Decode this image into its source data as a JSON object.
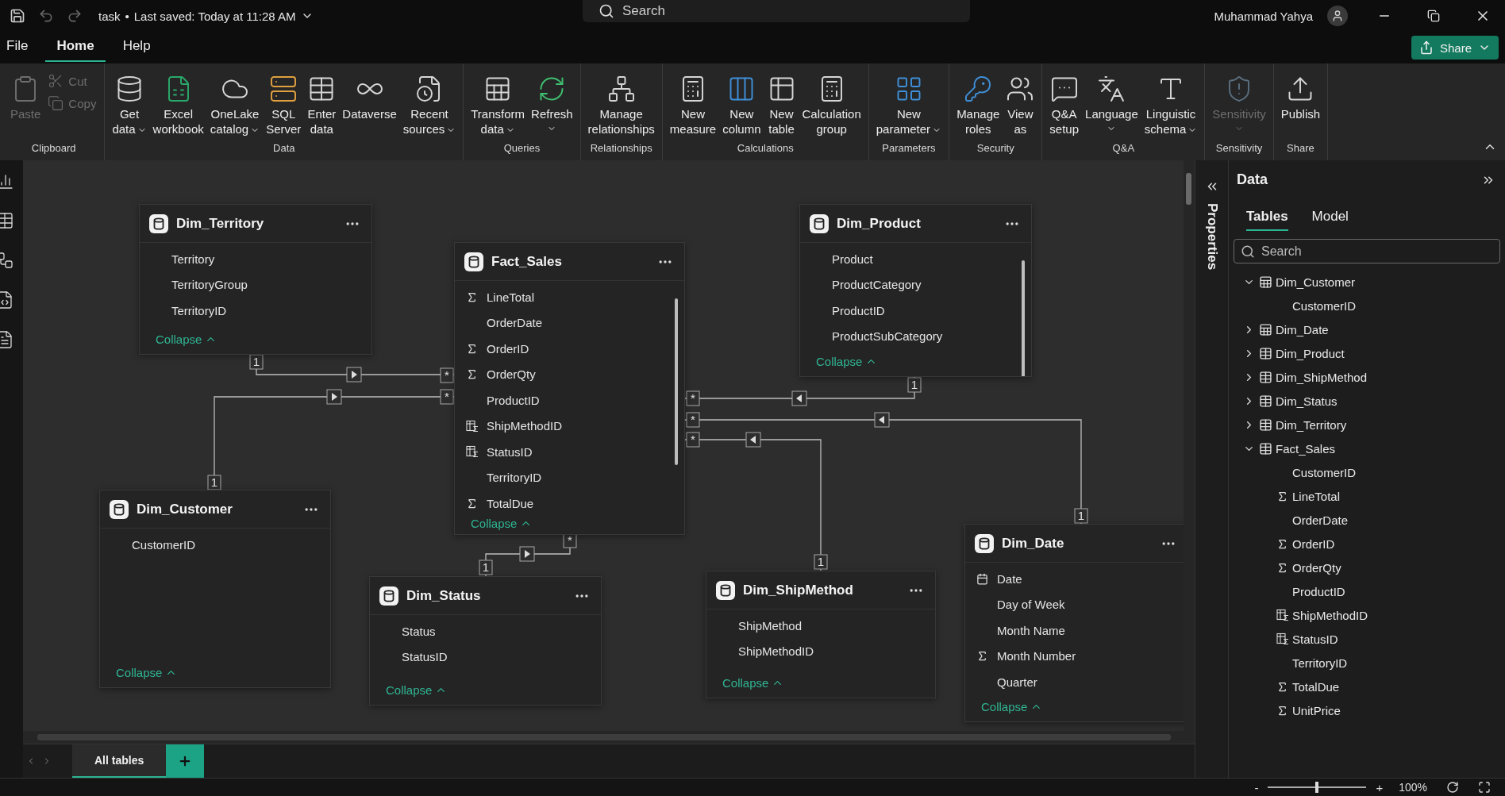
{
  "title_bar": {
    "file_name": "task",
    "separator": "•",
    "saved": "Last saved: Today at 11:28 AM",
    "search_placeholder": "Search",
    "user": "Muhammad Yahya"
  },
  "menu": [
    {
      "label": "File",
      "selected": false
    },
    {
      "label": "Home",
      "selected": true
    },
    {
      "label": "Help",
      "selected": false
    }
  ],
  "share_button": "Share",
  "ribbon": [
    {
      "label": "Clipboard",
      "buttons": [
        {
          "kind": "large",
          "lines": [
            "Paste"
          ],
          "dropdown": false,
          "disabled": true
        },
        {
          "kind": "small",
          "lines": [
            "Cut"
          ],
          "disabled": true
        },
        {
          "kind": "small",
          "lines": [
            "Copy"
          ],
          "disabled": true
        }
      ]
    },
    {
      "label": "Data",
      "buttons": [
        {
          "kind": "large",
          "lines": [
            "Get",
            "data"
          ],
          "dropdown": true,
          "disabled": false
        },
        {
          "kind": "large",
          "lines": [
            "Excel",
            "workbook"
          ],
          "dropdown": false,
          "disabled": false
        },
        {
          "kind": "large",
          "lines": [
            "OneLake",
            "catalog"
          ],
          "dropdown": true,
          "disabled": false
        },
        {
          "kind": "large",
          "lines": [
            "SQL",
            "Server"
          ],
          "dropdown": false,
          "disabled": false
        },
        {
          "kind": "large",
          "lines": [
            "Enter",
            "data"
          ],
          "dropdown": false,
          "disabled": false
        },
        {
          "kind": "large",
          "lines": [
            "Dataverse"
          ],
          "dropdown": false,
          "disabled": false
        },
        {
          "kind": "large",
          "lines": [
            "Recent",
            "sources"
          ],
          "dropdown": true,
          "disabled": false
        }
      ]
    },
    {
      "label": "Queries",
      "buttons": [
        {
          "kind": "large",
          "lines": [
            "Transform",
            "data"
          ],
          "dropdown": true,
          "disabled": false
        },
        {
          "kind": "large",
          "lines": [
            "Refresh"
          ],
          "dropdown": true,
          "disabled": false
        }
      ]
    },
    {
      "label": "Relationships",
      "buttons": [
        {
          "kind": "large",
          "lines": [
            "Manage",
            "relationships"
          ],
          "dropdown": false,
          "disabled": false
        }
      ]
    },
    {
      "label": "Calculations",
      "buttons": [
        {
          "kind": "large",
          "lines": [
            "New",
            "measure"
          ],
          "dropdown": false,
          "disabled": false
        },
        {
          "kind": "large",
          "lines": [
            "New",
            "column"
          ],
          "dropdown": false,
          "disabled": false
        },
        {
          "kind": "large",
          "lines": [
            "New",
            "table"
          ],
          "dropdown": false,
          "disabled": false
        },
        {
          "kind": "large",
          "lines": [
            "Calculation",
            "group"
          ],
          "dropdown": false,
          "disabled": false
        }
      ]
    },
    {
      "label": "Parameters",
      "buttons": [
        {
          "kind": "large",
          "lines": [
            "New",
            "parameter"
          ],
          "dropdown": true,
          "disabled": false
        }
      ]
    },
    {
      "label": "Security",
      "buttons": [
        {
          "kind": "large",
          "lines": [
            "Manage",
            "roles"
          ],
          "dropdown": false,
          "disabled": false
        },
        {
          "kind": "large",
          "lines": [
            "View",
            "as"
          ],
          "dropdown": false,
          "disabled": false
        }
      ]
    },
    {
      "label": "Q&A",
      "buttons": [
        {
          "kind": "large",
          "lines": [
            "Q&A",
            "setup"
          ],
          "dropdown": false,
          "disabled": false
        },
        {
          "kind": "large",
          "lines": [
            "Language"
          ],
          "dropdown": true,
          "disabled": false
        },
        {
          "kind": "large",
          "lines": [
            "Linguistic",
            "schema"
          ],
          "dropdown": true,
          "disabled": false
        }
      ]
    },
    {
      "label": "Sensitivity",
      "buttons": [
        {
          "kind": "large",
          "lines": [
            "Sensitivity"
          ],
          "dropdown": true,
          "disabled": true
        }
      ]
    },
    {
      "label": "Share",
      "buttons": [
        {
          "kind": "large",
          "lines": [
            "Publish"
          ],
          "dropdown": false,
          "disabled": false
        }
      ]
    }
  ],
  "tables": [
    {
      "name": "Dim_Territory",
      "scrollable": false,
      "collapse": "Collapse",
      "fields": [
        {
          "name": "Territory",
          "kind": "plain"
        },
        {
          "name": "TerritoryGroup",
          "kind": "plain"
        },
        {
          "name": "TerritoryID",
          "kind": "plain"
        }
      ]
    },
    {
      "name": "Fact_Sales",
      "scrollable": true,
      "collapse": "Collapse",
      "fields": [
        {
          "name": "LineTotal",
          "kind": "sum"
        },
        {
          "name": "OrderDate",
          "kind": "plain"
        },
        {
          "name": "OrderID",
          "kind": "sum"
        },
        {
          "name": "OrderQty",
          "kind": "sum"
        },
        {
          "name": "ProductID",
          "kind": "plain"
        },
        {
          "name": "ShipMethodID",
          "kind": "calc"
        },
        {
          "name": "StatusID",
          "kind": "calc"
        },
        {
          "name": "TerritoryID",
          "kind": "plain"
        },
        {
          "name": "TotalDue",
          "kind": "sum"
        }
      ]
    },
    {
      "name": "Dim_Product",
      "scrollable": true,
      "collapse": "Collapse",
      "fields": [
        {
          "name": "Product",
          "kind": "plain"
        },
        {
          "name": "ProductCategory",
          "kind": "plain"
        },
        {
          "name": "ProductID",
          "kind": "plain"
        },
        {
          "name": "ProductSubCategory",
          "kind": "plain"
        }
      ]
    },
    {
      "name": "Dim_Customer",
      "scrollable": false,
      "collapse": "Collapse",
      "fields": [
        {
          "name": "CustomerID",
          "kind": "plain"
        }
      ]
    },
    {
      "name": "Dim_Status",
      "scrollable": false,
      "collapse": "Collapse",
      "fields": [
        {
          "name": "Status",
          "kind": "plain"
        },
        {
          "name": "StatusID",
          "kind": "plain"
        }
      ]
    },
    {
      "name": "Dim_ShipMethod",
      "scrollable": false,
      "collapse": "Collapse",
      "fields": [
        {
          "name": "ShipMethod",
          "kind": "plain"
        },
        {
          "name": "ShipMethodID",
          "kind": "plain"
        }
      ]
    },
    {
      "name": "Dim_Date",
      "scrollable": false,
      "collapse": "Collapse",
      "fields": [
        {
          "name": "Date",
          "kind": "date"
        },
        {
          "name": "Day of Week",
          "kind": "plain"
        },
        {
          "name": "Month Name",
          "kind": "plain"
        },
        {
          "name": "Month Number",
          "kind": "sum"
        },
        {
          "name": "Quarter",
          "kind": "plain"
        }
      ]
    }
  ],
  "relationships": [
    {
      "one": "1",
      "many": "*",
      "points_right": true
    },
    {
      "one": "1",
      "many": "*",
      "points_right": true
    },
    {
      "one": "1",
      "many": "*",
      "points_right": true
    },
    {
      "one": "1",
      "many": "*",
      "points_right": false
    },
    {
      "one": "1",
      "many": "*",
      "points_right": false
    },
    {
      "one": "1",
      "many": "*",
      "points_right": false
    }
  ],
  "layout_tabs": [
    {
      "label": "All tables",
      "selected": true
    }
  ],
  "properties_label": "Properties",
  "data_panel": {
    "title": "Data",
    "tabs": [
      {
        "label": "Tables",
        "selected": true
      },
      {
        "label": "Model",
        "selected": false
      }
    ],
    "search_placeholder": "Search",
    "tree": [
      {
        "label": "Dim_Customer",
        "kind": "calc_table",
        "expanded": true,
        "children": [
          {
            "label": "CustomerID",
            "kind": "plain"
          }
        ]
      },
      {
        "label": "Dim_Date",
        "kind": "calc_table",
        "expanded": false
      },
      {
        "label": "Dim_Product",
        "kind": "table",
        "expanded": false
      },
      {
        "label": "Dim_ShipMethod",
        "kind": "table",
        "expanded": false
      },
      {
        "label": "Dim_Status",
        "kind": "table",
        "expanded": false
      },
      {
        "label": "Dim_Territory",
        "kind": "table",
        "expanded": false
      },
      {
        "label": "Fact_Sales",
        "kind": "table",
        "expanded": true,
        "children": [
          {
            "label": "CustomerID",
            "kind": "plain"
          },
          {
            "label": "LineTotal",
            "kind": "sum"
          },
          {
            "label": "OrderDate",
            "kind": "plain"
          },
          {
            "label": "OrderID",
            "kind": "sum"
          },
          {
            "label": "OrderQty",
            "kind": "sum"
          },
          {
            "label": "ProductID",
            "kind": "plain"
          },
          {
            "label": "ShipMethodID",
            "kind": "calc"
          },
          {
            "label": "StatusID",
            "kind": "calc"
          },
          {
            "label": "TerritoryID",
            "kind": "plain"
          },
          {
            "label": "TotalDue",
            "kind": "sum"
          },
          {
            "label": "UnitPrice",
            "kind": "sum"
          }
        ]
      }
    ]
  },
  "status_bar": {
    "zoom_out": "-",
    "zoom_in": "+",
    "zoom": {
      "level": 0.5
    },
    "zoom_label": "100%"
  }
}
